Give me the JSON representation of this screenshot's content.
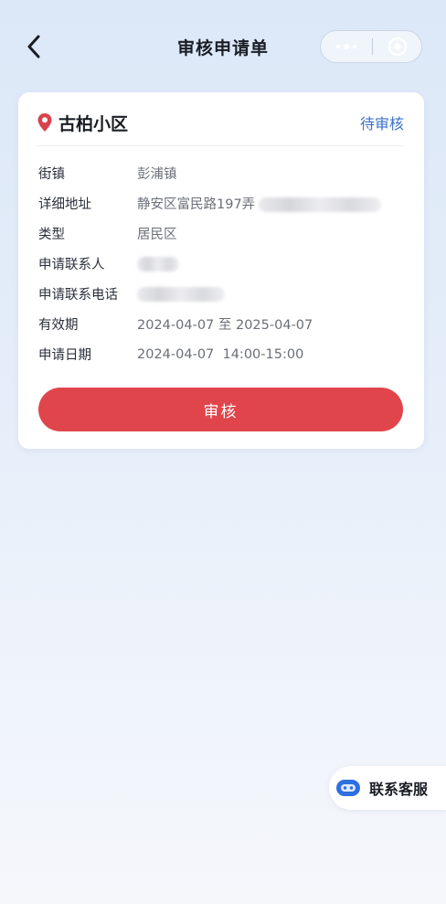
{
  "nav": {
    "title": "审核申请单",
    "back_icon": "chevron-left-icon",
    "more_icon": "ellipsis-icon",
    "close_icon": "target-circle-icon"
  },
  "card": {
    "location_icon": "map-pin-icon",
    "location_name": "古柏小区",
    "status": "待审核",
    "status_color": "#3c72c8",
    "rows": [
      {
        "label": "街镇",
        "value": "彭浦镇"
      },
      {
        "label": "详细地址",
        "value": "静安区富民路197弄"
      },
      {
        "label": "类型",
        "value": "居民区"
      },
      {
        "label": "申请联系人",
        "value": ""
      },
      {
        "label": "申请联系电话",
        "value": ""
      },
      {
        "label": "有效期",
        "value": "2024-04-07 至 2025-04-07"
      },
      {
        "label": "申请日期",
        "value": "2024-04-07  14:00-15:00"
      }
    ],
    "audit_button": "审核",
    "audit_button_color": "#e0454b"
  },
  "service": {
    "icon": "robot-chat-icon",
    "label": "联系客服"
  }
}
